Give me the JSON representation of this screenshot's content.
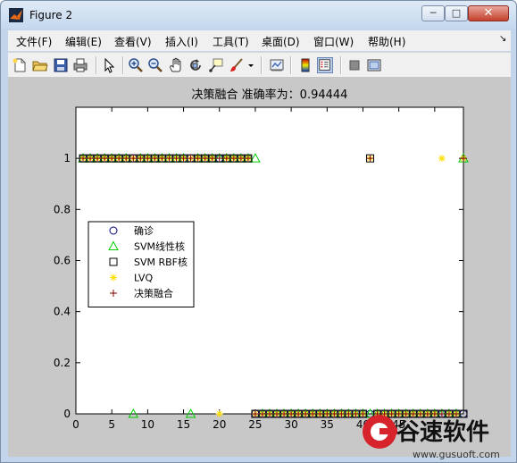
{
  "window": {
    "title": "Figure 2",
    "minimize_label": "─",
    "maximize_label": "□",
    "close_label": "✕"
  },
  "menu": [
    {
      "label": "文件(F)"
    },
    {
      "label": "编辑(E)"
    },
    {
      "label": "查看(V)"
    },
    {
      "label": "插入(I)"
    },
    {
      "label": "工具(T)"
    },
    {
      "label": "桌面(D)"
    },
    {
      "label": "窗口(W)"
    },
    {
      "label": "帮助(H)"
    }
  ],
  "toolbar_icons": [
    "new-figure-icon",
    "open-file-icon",
    "save-icon",
    "print-icon",
    "pointer-icon",
    "zoom-in-icon",
    "zoom-out-icon",
    "pan-hand-icon",
    "rotate-3d-icon",
    "data-cursor-icon",
    "brush-icon",
    "brush-dropdown-icon",
    "link-plot-icon",
    "colorbar-icon",
    "legend-icon",
    "hide-plot-tools-icon",
    "show-plot-tools-icon"
  ],
  "watermark": {
    "brand": "谷速软件",
    "url": "www.gusuoft.com",
    "logo_letter": "G"
  },
  "chart_data": {
    "type": "scatter",
    "title": "决策融合 准确率为：0.94444",
    "xlabel": "",
    "ylabel": "",
    "xlim": [
      0,
      54
    ],
    "ylim": [
      0,
      1.2
    ],
    "xticks": [
      0,
      5,
      10,
      15,
      20,
      25,
      30,
      35,
      40,
      45,
      50
    ],
    "xtick_labels": [
      "0",
      "5",
      "10",
      "15",
      "20",
      "25",
      "30",
      "35",
      "40",
      "45",
      ""
    ],
    "yticks": [
      0,
      0.2,
      0.4,
      0.6,
      0.8,
      1
    ],
    "ytick_labels": [
      "0",
      "0.2",
      "0.4",
      "0.6",
      "0.8",
      "1"
    ],
    "legend_position": "left",
    "grid": false,
    "series": [
      {
        "name": "确诊",
        "marker": "circle",
        "color": "#00007f",
        "x": [
          1,
          2,
          3,
          4,
          5,
          6,
          7,
          8,
          9,
          10,
          11,
          12,
          13,
          14,
          15,
          16,
          17,
          18,
          19,
          20,
          21,
          22,
          23,
          24,
          25,
          26,
          27,
          28,
          29,
          30,
          31,
          32,
          33,
          34,
          35,
          36,
          37,
          38,
          39,
          40,
          41,
          42,
          43,
          44,
          45,
          46,
          47,
          48,
          49,
          50,
          51,
          52,
          53,
          54
        ],
        "y": [
          1,
          1,
          1,
          1,
          1,
          1,
          1,
          1,
          1,
          1,
          1,
          1,
          1,
          1,
          1,
          1,
          1,
          1,
          1,
          1,
          1,
          1,
          1,
          1,
          0,
          0,
          0,
          0,
          0,
          0,
          0,
          0,
          0,
          0,
          0,
          0,
          0,
          0,
          0,
          0,
          0,
          0,
          0,
          0,
          0,
          0,
          0,
          0,
          0,
          0,
          0,
          0,
          0,
          0
        ]
      },
      {
        "name": "SVM线性核",
        "marker": "triangle",
        "color": "#00cc00",
        "x": [
          1,
          2,
          3,
          4,
          5,
          6,
          7,
          8,
          9,
          10,
          11,
          12,
          13,
          14,
          15,
          16,
          17,
          18,
          19,
          20,
          21,
          22,
          23,
          24,
          25,
          26,
          27,
          28,
          29,
          30,
          31,
          32,
          33,
          34,
          35,
          36,
          37,
          38,
          39,
          40,
          41,
          42,
          43,
          44,
          45,
          46,
          47,
          48,
          49,
          50,
          51,
          52,
          53,
          54
        ],
        "y": [
          1,
          1,
          1,
          1,
          1,
          1,
          1,
          0,
          1,
          1,
          1,
          1,
          1,
          1,
          1,
          0,
          1,
          1,
          1,
          1,
          1,
          1,
          1,
          1,
          1,
          0,
          0,
          0,
          0,
          0,
          0,
          0,
          0,
          0,
          0,
          0,
          0,
          0,
          0,
          0,
          0,
          0,
          0,
          0,
          0,
          0,
          0,
          0,
          0,
          0,
          0,
          0,
          0,
          1
        ]
      },
      {
        "name": "SVM RBF核",
        "marker": "square",
        "color": "#000000",
        "x": [
          1,
          2,
          3,
          4,
          5,
          6,
          7,
          8,
          9,
          10,
          11,
          12,
          13,
          14,
          15,
          16,
          17,
          18,
          19,
          20,
          21,
          22,
          23,
          24,
          25,
          26,
          27,
          28,
          29,
          30,
          31,
          32,
          33,
          34,
          35,
          36,
          37,
          38,
          39,
          40,
          41,
          42,
          43,
          44,
          45,
          46,
          47,
          48,
          49,
          50,
          51,
          52,
          53,
          54
        ],
        "y": [
          1,
          1,
          1,
          1,
          1,
          1,
          1,
          1,
          1,
          1,
          1,
          1,
          1,
          1,
          1,
          1,
          1,
          1,
          1,
          1,
          1,
          1,
          1,
          1,
          0,
          0,
          0,
          0,
          0,
          0,
          0,
          0,
          0,
          0,
          0,
          0,
          0,
          0,
          0,
          0,
          1,
          0,
          0,
          0,
          0,
          0,
          0,
          0,
          0,
          0,
          0,
          0,
          0,
          0
        ]
      },
      {
        "name": "LVQ",
        "marker": "star",
        "color": "#ffdd00",
        "x": [
          1,
          2,
          3,
          4,
          5,
          6,
          7,
          8,
          9,
          10,
          11,
          12,
          13,
          14,
          15,
          16,
          17,
          18,
          19,
          20,
          21,
          22,
          23,
          24,
          25,
          26,
          27,
          28,
          29,
          30,
          31,
          32,
          33,
          34,
          35,
          36,
          37,
          38,
          39,
          40,
          41,
          42,
          43,
          44,
          45,
          46,
          47,
          48,
          49,
          50,
          51,
          52,
          53,
          54
        ],
        "y": [
          1,
          1,
          1,
          1,
          1,
          1,
          1,
          1,
          1,
          1,
          1,
          1,
          1,
          1,
          1,
          1,
          1,
          1,
          1,
          0,
          1,
          1,
          1,
          1,
          0,
          0,
          0,
          0,
          0,
          0,
          0,
          0,
          0,
          0,
          0,
          0,
          0,
          0,
          0,
          0,
          1,
          0,
          0,
          0,
          0,
          0,
          0,
          0,
          0,
          0,
          1,
          0,
          0,
          1
        ]
      },
      {
        "name": "决策融合",
        "marker": "plus",
        "color": "#7f0000",
        "x": [
          1,
          2,
          3,
          4,
          5,
          6,
          7,
          8,
          9,
          10,
          11,
          12,
          13,
          14,
          15,
          16,
          17,
          18,
          19,
          20,
          21,
          22,
          23,
          24,
          25,
          26,
          27,
          28,
          29,
          30,
          31,
          32,
          33,
          34,
          35,
          36,
          37,
          38,
          39,
          40,
          41,
          42,
          43,
          44,
          45,
          46,
          47,
          48,
          49,
          50,
          51,
          52,
          53,
          54
        ],
        "y": [
          1,
          1,
          1,
          1,
          1,
          1,
          1,
          1,
          1,
          1,
          1,
          1,
          1,
          1,
          1,
          1,
          1,
          1,
          1,
          1,
          1,
          1,
          1,
          1,
          0,
          0,
          0,
          0,
          0,
          0,
          0,
          0,
          0,
          0,
          0,
          0,
          0,
          0,
          0,
          0,
          1,
          0,
          0,
          0,
          0,
          0,
          0,
          0,
          0,
          0,
          0,
          0,
          0,
          1
        ]
      }
    ]
  }
}
